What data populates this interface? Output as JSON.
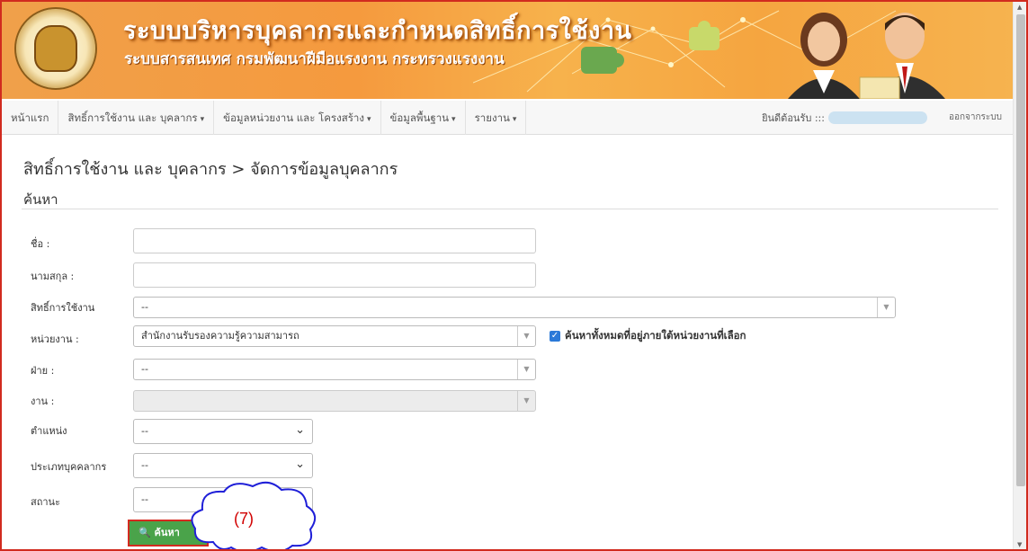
{
  "header": {
    "title": "ระบบบริหารบุคลากรและกำหนดสิทธิ์การใช้งาน",
    "subtitle": "ระบบสารสนเทศ กรมพัฒนาฝีมือแรงงาน กระทรวงแรงงาน",
    "logo_icon": "department-seal-icon"
  },
  "nav": {
    "items": [
      {
        "label": "หน้าแรก",
        "dropdown": false
      },
      {
        "label": "สิทธิ์การใช้งาน และ บุคลากร",
        "dropdown": true
      },
      {
        "label": "ข้อมูลหน่วยงาน และ โครงสร้าง",
        "dropdown": true
      },
      {
        "label": "ข้อมูลพื้นฐาน",
        "dropdown": true
      },
      {
        "label": "รายงาน",
        "dropdown": true
      }
    ],
    "caret": "▾",
    "welcome": "ยินดีต้อนรับ :::",
    "logout": "ออกจากระบบ"
  },
  "page": {
    "breadcrumb": "สิทธิ์การใช้งาน และ บุคลากร > จัดการข้อมูลบุคลากร",
    "section_title": "ค้นหา"
  },
  "form": {
    "first_name_label": "ชื่อ :",
    "first_name_value": "",
    "last_name_label": "นามสกุล :",
    "last_name_value": "",
    "permission_label": "สิทธิ์การใช้งาน",
    "permission_value": "--",
    "unit_label": "หน่วยงาน :",
    "unit_value": "สำนักงานรับรองความรู้ความสามารถ",
    "include_sub_units_label": "ค้นหาทั้งหมดที่อยู่ภายใต้หน่วยงานที่เลือก",
    "include_sub_units_checked": true,
    "division_label": "ฝ่าย :",
    "division_value": "--",
    "job_label": "งาน :",
    "job_value": "",
    "position_label": "ตำแหน่ง",
    "position_value": "--",
    "personnel_type_label": "ประเภทบุคคลากร",
    "personnel_type_value": "--",
    "status_label": "สถานะ",
    "status_value": "--",
    "search_button": "ค้นหา"
  },
  "annotation": {
    "callout": "(7)"
  },
  "colors": {
    "banner": "#f59a3e",
    "highlight_border": "#d42a1f",
    "button": "#4aa34a",
    "callout_text": "#d10000"
  }
}
